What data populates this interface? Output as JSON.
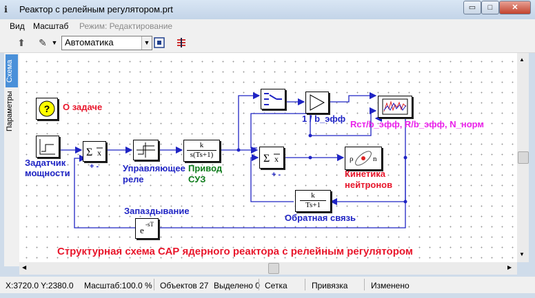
{
  "window": {
    "title": "Реактор с релейным регулятором.prt",
    "minimize_glyph": "▭",
    "maximize_glyph": "□",
    "close_glyph": "✕"
  },
  "menu": {
    "view": "Вид",
    "scale": "Масштаб",
    "mode": "Режим: Редактирование"
  },
  "toolbar": {
    "mode_select_value": "Автоматика"
  },
  "side_tabs": {
    "scheme": "Схема",
    "params": "Параметры"
  },
  "icons": {
    "app": "app-logo-icon",
    "arrow_up": "arrow-up-icon",
    "tool": "build-tool-icon",
    "grid": "grid-toggle-icon",
    "run": "run-model-icon"
  },
  "diagram": {
    "task_label": "О задаче",
    "task_icon_glyph": "?",
    "setter_label_1": "Задатчик",
    "setter_label_2": "мощности",
    "sum1_signs": "+ -",
    "sum2_signs": "+ -",
    "relay_label_1": "Управляющее",
    "relay_label_2": "реле",
    "drive_label_1": "Привод",
    "drive_label_2": "СУЗ",
    "drive_numerator": "k",
    "drive_denominator": "s(Ts+1)",
    "gain_label": "1 / b_эфф",
    "plot_label": "Rст/b_эфф, R/b_эфф, N_норм",
    "kinetics_label_1": "Кинетика",
    "kinetics_label_2": "нейтронов",
    "kinetics_p": "ρ",
    "kinetics_n": "n",
    "feedback_label": "Обратная связь",
    "feedback_numerator": "k",
    "feedback_denominator": "Ts+1",
    "delay_label": "Запаздывание",
    "delay_text": "e",
    "delay_exp": "-sT",
    "sum_text": "Σ",
    "sum_bar": "x",
    "caption": "Структурная схема САР ядерного реактора с релейным регулятором"
  },
  "status": {
    "coords": "X:3720.0 Y:2380.0",
    "scale": "Масштаб:100.0 %",
    "objects": "Объектов 27",
    "selected": "Выделено 0",
    "grid": "Сетка",
    "snap": "Привязка",
    "changed": "Изменено"
  },
  "colors": {
    "wire": "#1f24c4",
    "block_border": "#000000",
    "caption": "#e8162b",
    "task_icon_fill": "#ffff00",
    "side_tab_active": "#4a90d9"
  }
}
